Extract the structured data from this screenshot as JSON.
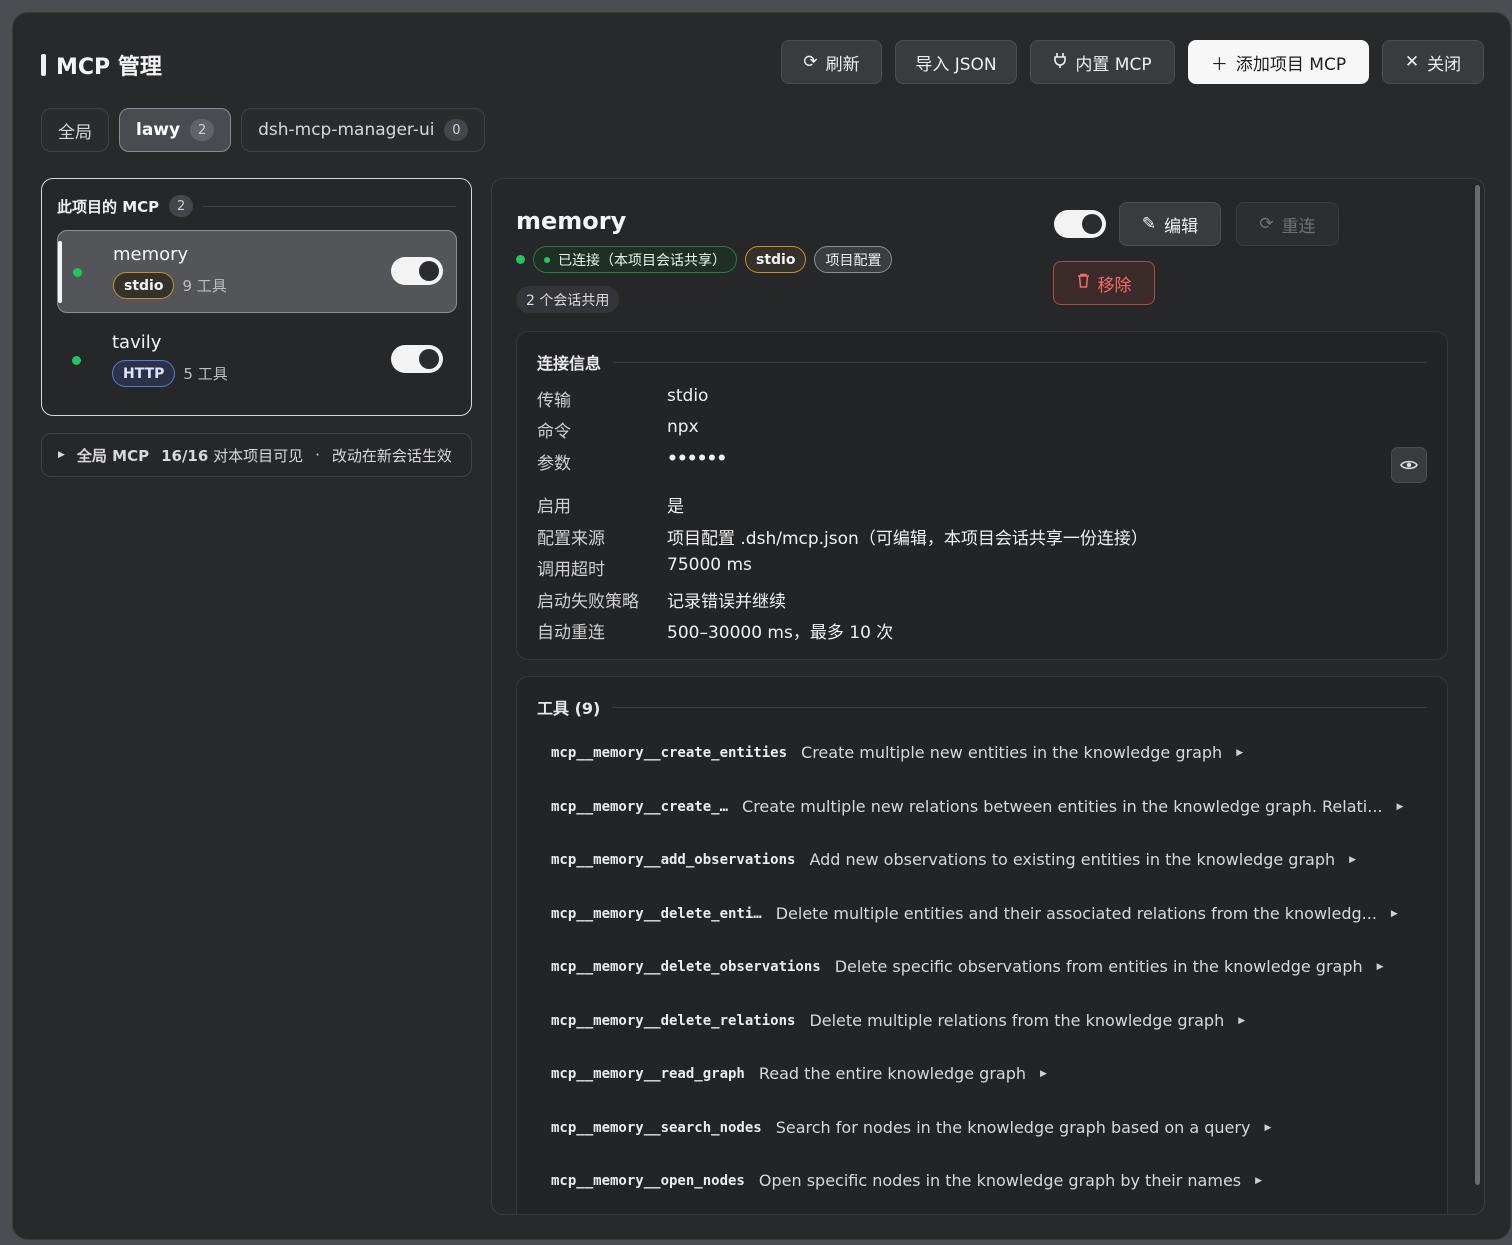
{
  "app": {
    "title": "MCP 管理"
  },
  "header": {
    "refresh": "刷新",
    "import_json": "导入 JSON",
    "builtin_mcp": "内置 MCP",
    "add_project_mcp": "添加项目 MCP",
    "close": "关闭"
  },
  "tabs": [
    {
      "label": "全局",
      "count": ""
    },
    {
      "label": "lawy",
      "count": "2"
    },
    {
      "label": "dsh-mcp-manager-ui",
      "count": "0"
    }
  ],
  "project_panel": {
    "title": "此项目的 MCP",
    "count": "2",
    "items": [
      {
        "name": "memory",
        "transport": "stdio",
        "tools": "9 工具",
        "enabled": true
      },
      {
        "name": "tavily",
        "transport": "HTTP",
        "tools": "5 工具",
        "enabled": true
      }
    ]
  },
  "global_bar": {
    "label": "全局 MCP",
    "visible": "16/16",
    "visible_suffix": "对本项目可见",
    "sep": "·",
    "note": "改动在新会话生效"
  },
  "detail": {
    "name": "memory",
    "status": "已连接（本项目会话共享）",
    "transport_badge": "stdio",
    "source_badge": "项目配置",
    "shared": "2 个会话共用",
    "edit": "编辑",
    "reconnect": "重连",
    "remove": "移除",
    "connection": {
      "title": "连接信息",
      "rows": [
        {
          "k": "传输",
          "v": "stdio"
        },
        {
          "k": "命令",
          "v": "npx"
        },
        {
          "k": "参数",
          "v": "••••••"
        },
        {
          "k": "启用",
          "v": "是"
        },
        {
          "k": "配置来源",
          "v": "项目配置 .dsh/mcp.json（可编辑，本项目会话共享一份连接）"
        },
        {
          "k": "调用超时",
          "v": "75000 ms"
        },
        {
          "k": "启动失败策略",
          "v": "记录错误并继续"
        },
        {
          "k": "自动重连",
          "v": "500–30000 ms，最多 10 次"
        }
      ]
    },
    "tools": {
      "title": "工具 (9)",
      "items": [
        {
          "name": "mcp__memory__create_entities",
          "desc": "Create multiple new entities in the knowledge graph"
        },
        {
          "name": "mcp__memory__create_…",
          "desc": "Create multiple new relations between entities in the knowledge graph. Relati..."
        },
        {
          "name": "mcp__memory__add_observations",
          "desc": "Add new observations to existing entities in the knowledge graph"
        },
        {
          "name": "mcp__memory__delete_enti…",
          "desc": "Delete multiple entities and their associated relations from the knowledg..."
        },
        {
          "name": "mcp__memory__delete_observations",
          "desc": "Delete specific observations from entities in the knowledge graph"
        },
        {
          "name": "mcp__memory__delete_relations",
          "desc": "Delete multiple relations from the knowledge graph"
        },
        {
          "name": "mcp__memory__read_graph",
          "desc": "Read the entire knowledge graph"
        },
        {
          "name": "mcp__memory__search_nodes",
          "desc": "Search for nodes in the knowledge graph based on a query"
        },
        {
          "name": "mcp__memory__open_nodes",
          "desc": "Open specific nodes in the knowledge graph by their names"
        }
      ]
    }
  },
  "colors": {
    "status_green": "#22c55e",
    "danger": "#f36b6b",
    "stdio_border": "#c8912f",
    "http_border": "#5a7bd1"
  }
}
